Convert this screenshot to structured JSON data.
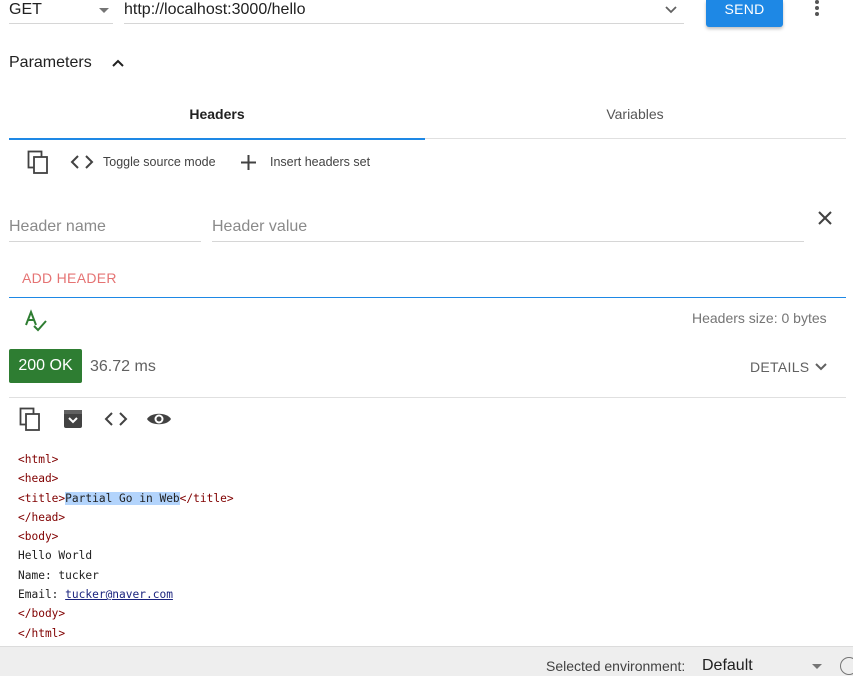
{
  "request": {
    "method": "GET",
    "url": "http://localhost:3000/hello",
    "send_label": "SEND"
  },
  "parameters": {
    "title": "Parameters",
    "tabs": [
      {
        "label": "Headers",
        "active": true
      },
      {
        "label": "Variables",
        "active": false
      }
    ],
    "toolbar": {
      "toggle_source_label": "Toggle source mode",
      "insert_headers_label": "Insert headers set"
    },
    "header_row": {
      "name_placeholder": "Header name",
      "value_placeholder": "Header value"
    },
    "add_header_label": "ADD HEADER",
    "headers_size": "Headers size: 0 bytes"
  },
  "response": {
    "status": "200 OK",
    "time": "36.72 ms",
    "details_label": "DETAILS",
    "code_lines": {
      "l1": "<html>",
      "l2": "<head>",
      "l3_open": "<title>",
      "l3_text": "Partial Go in Web",
      "l3_close": "</title>",
      "l4": "</head>",
      "l5": "<body>",
      "l6": "Hello World",
      "l7": "Name: tucker",
      "l8_label": "Email: ",
      "l8_link": "tucker@naver.com",
      "l9": "</body>",
      "l10": "</html>"
    }
  },
  "footer": {
    "env_label": "Selected environment:",
    "env_value": "Default"
  },
  "colors": {
    "accent": "#1e88e5",
    "status_ok": "#2e7d32",
    "add_header": "#e57373"
  },
  "icons": [
    "chevron-down-icon",
    "more-vert-icon",
    "chevron-up-icon",
    "copy-icon",
    "code-icon",
    "plus-icon",
    "close-icon",
    "spellcheck-icon",
    "save-icon",
    "eye-icon",
    "info-icon"
  ]
}
